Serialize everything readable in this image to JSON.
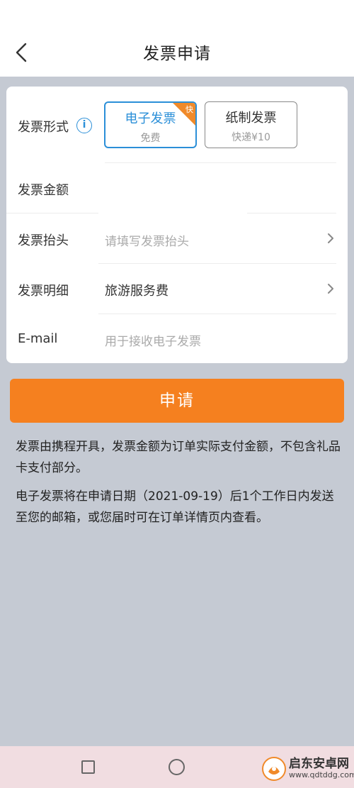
{
  "header": {
    "title": "发票申请"
  },
  "form": {
    "type": {
      "label": "发票形式",
      "info_icon": "i",
      "options": [
        {
          "title": "电子发票",
          "subtitle": "免费",
          "badge": "快",
          "selected": true
        },
        {
          "title": "纸制发票",
          "subtitle": "快递¥10",
          "selected": false
        }
      ]
    },
    "amount": {
      "label": "发票金额",
      "value": ""
    },
    "header_field": {
      "label": "发票抬头",
      "placeholder": "请填写发票抬头"
    },
    "detail": {
      "label": "发票明细",
      "value": "旅游服务费"
    },
    "email": {
      "label": "E-mail",
      "placeholder": "用于接收电子发票"
    }
  },
  "submit_label": "申请",
  "notes": [
    "发票由携程开具，发票金额为订单实际支付金额，不包含礼品卡支付部分。",
    "电子发票将在申请日期（2021-09-19）后1个工作日内发送至您的邮箱，或您届时可在订单详情页内查看。"
  ],
  "watermark": {
    "name": "启东安卓网",
    "url": "www.qdtddg.com"
  },
  "colors": {
    "accent": "#2b8fd8",
    "primary_button": "#f5801f",
    "badge": "#f08a2a",
    "background": "#c5cad3"
  },
  "icons": [
    "back-arrow-icon",
    "info-icon",
    "chevron-right-icon",
    "nav-recents-icon",
    "nav-home-icon"
  ]
}
